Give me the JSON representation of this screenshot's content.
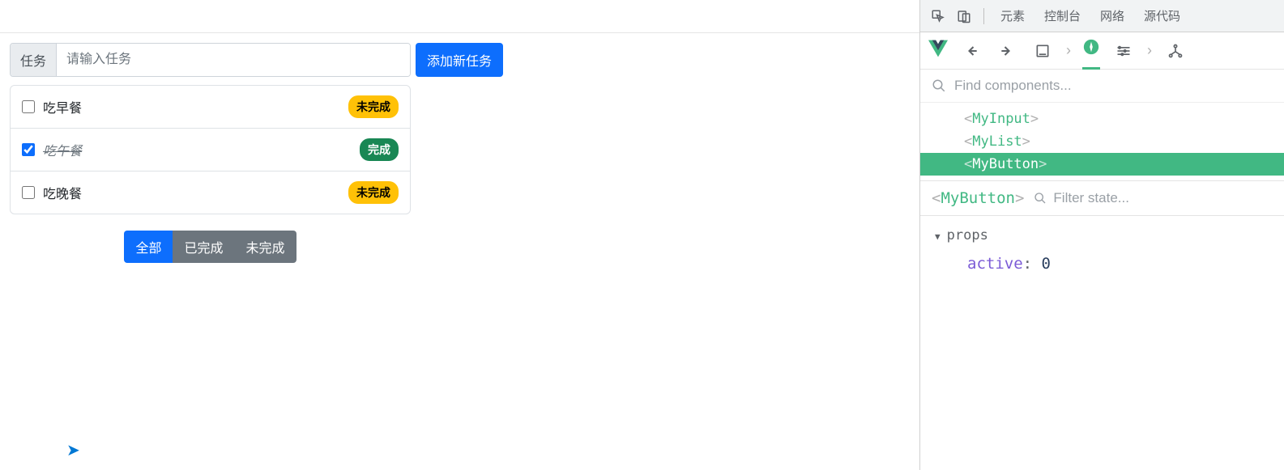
{
  "input": {
    "label": "任务",
    "placeholder": "请输入任务",
    "add_button": "添加新任务"
  },
  "tasks": [
    {
      "text": "吃早餐",
      "done": false,
      "badge": "未完成"
    },
    {
      "text": "吃午餐",
      "done": true,
      "badge": "完成"
    },
    {
      "text": "吃晚餐",
      "done": false,
      "badge": "未完成"
    }
  ],
  "filters": {
    "all": "全部",
    "done": "已完成",
    "undone": "未完成"
  },
  "devtools": {
    "tabs": {
      "elements": "元素",
      "console": "控制台",
      "network": "网络",
      "sources": "源代码"
    },
    "search_placeholder": "Find components...",
    "tree": {
      "node0": "MyInput",
      "node1": "MyList",
      "node2": "MyButton"
    },
    "selected_component": "MyButton",
    "filter_state_placeholder": "Filter state...",
    "props_label": "props",
    "prop_key": "active",
    "prop_value": "0"
  }
}
